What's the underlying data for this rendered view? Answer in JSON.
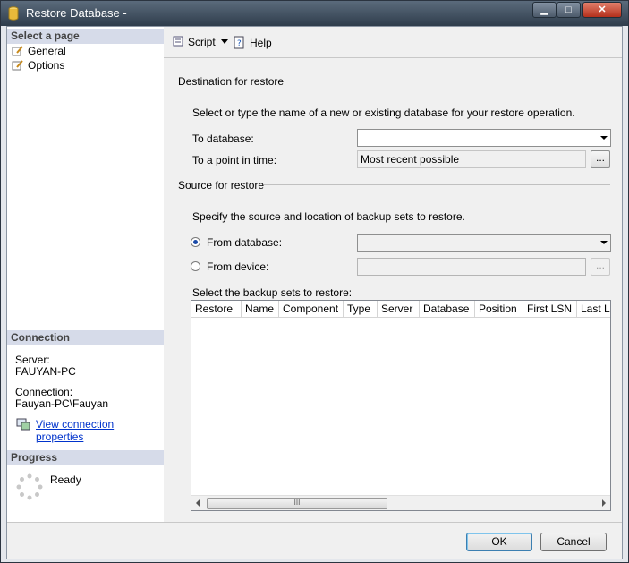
{
  "window": {
    "title": "Restore Database -",
    "minimize": "▁",
    "maximize": "□",
    "close": "✕"
  },
  "left": {
    "select_page_header": "Select a page",
    "pages": [
      "General",
      "Options"
    ],
    "connection_header": "Connection",
    "server_label": "Server:",
    "server_value": "FAUYAN-PC",
    "connection_label": "Connection:",
    "connection_value": "Fauyan-PC\\Fauyan",
    "view_properties_link": "View connection properties",
    "progress_header": "Progress",
    "progress_status": "Ready"
  },
  "toolbar": {
    "script_label": "Script",
    "help_label": "Help"
  },
  "destination": {
    "group_label": "Destination for restore",
    "instruction": "Select or type the name of a new or existing database for your restore operation.",
    "to_database_label": "To database:",
    "to_database_value": "",
    "point_in_time_label": "To a point in time:",
    "point_in_time_value": "Most recent possible",
    "browse_label": "..."
  },
  "source": {
    "group_label": "Source for restore",
    "instruction": "Specify the source and location of backup sets to restore.",
    "from_database_label": "From database:",
    "from_database_selected": true,
    "from_device_label": "From device:",
    "browse_label": "...",
    "backup_sets_label": "Select the backup sets to restore:"
  },
  "grid": {
    "columns": [
      "Restore",
      "Name",
      "Component",
      "Type",
      "Server",
      "Database",
      "Position",
      "First LSN",
      "Last LSN"
    ],
    "rows": [],
    "scroll_grip": "III"
  },
  "footer": {
    "ok_label": "OK",
    "cancel_label": "Cancel"
  },
  "colors": {
    "link": "#0033cc",
    "section_header": "#d6dbe9",
    "close_button": "#c8452f"
  }
}
